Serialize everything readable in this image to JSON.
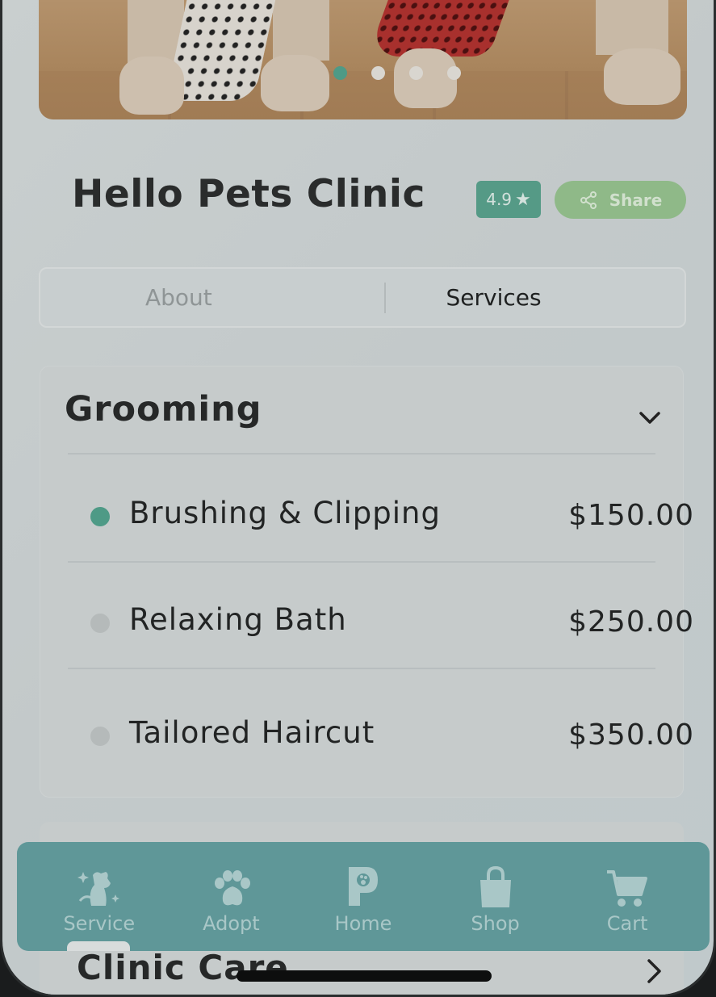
{
  "clinic": {
    "name": "Hello Pets Clinic",
    "rating": "4.9",
    "share_label": "Share"
  },
  "carousel": {
    "slides": 4,
    "active_index": 0
  },
  "tabs": [
    {
      "label": "About",
      "active": false
    },
    {
      "label": "Services",
      "active": true
    }
  ],
  "categories": [
    {
      "title": "Grooming",
      "expanded": true,
      "services": [
        {
          "name": "Brushing & Clipping",
          "price": "$150.00",
          "selected": true
        },
        {
          "name": "Relaxing Bath",
          "price": "$250.00",
          "selected": false
        },
        {
          "name": "Tailored Haircut",
          "price": "$350.00",
          "selected": false
        }
      ]
    },
    {
      "title": "Clinic Care",
      "expanded": false
    }
  ],
  "bottom_nav": [
    {
      "label": "Service",
      "icon": "dog-grooming-icon",
      "active": true
    },
    {
      "label": "Adopt",
      "icon": "paw-icon",
      "active": false
    },
    {
      "label": "Home",
      "icon": "app-logo-icon",
      "active": false
    },
    {
      "label": "Shop",
      "icon": "shopping-bag-icon",
      "active": false
    },
    {
      "label": "Cart",
      "icon": "cart-icon",
      "active": false
    }
  ],
  "colors": {
    "accent": "#4e9a86",
    "share": "#8fb988",
    "nav_bg": "#5f9798",
    "text": "#262828"
  }
}
